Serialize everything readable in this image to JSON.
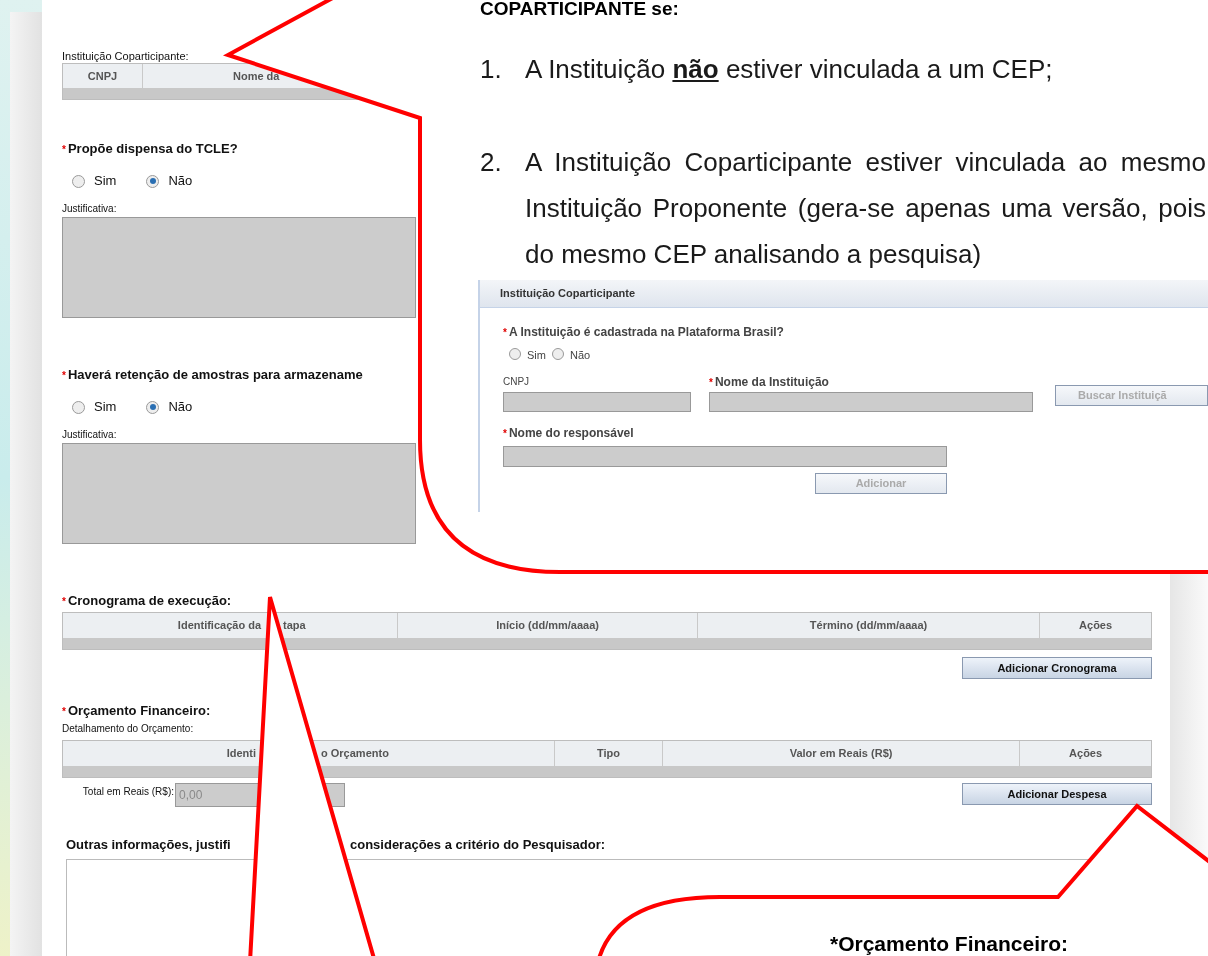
{
  "form": {
    "coparticipante": {
      "label": "Instituição Coparticipante:",
      "columns": [
        "CNPJ",
        "Nome da"
      ]
    },
    "questions": [
      {
        "marker": "*",
        "label": "Propõe dispensa do TCLE?",
        "options": [
          {
            "label": "Sim",
            "selected": false
          },
          {
            "label": "Não",
            "selected": true
          }
        ],
        "justification_label": "Justificativa:"
      },
      {
        "marker": "*",
        "label": "Haverá retenção de amostras para armazename",
        "options": [
          {
            "label": "Sim",
            "selected": false
          },
          {
            "label": "Não",
            "selected": true
          }
        ],
        "justification_label": "Justificativa:"
      }
    ],
    "cronograma": {
      "marker": "*",
      "label": "Cronograma de execução:",
      "columns": [
        {
          "parts": [
            "Identificação da",
            "tapa"
          ]
        },
        {
          "parts": [
            "Início (dd/mm/aaaa)"
          ]
        },
        {
          "parts": [
            "Término (dd/mm/aaaa)"
          ]
        },
        {
          "parts": [
            "Ações"
          ]
        }
      ],
      "button": "Adicionar Cronograma"
    },
    "orcamento": {
      "marker": "*",
      "label": "Orçamento Financeiro:",
      "sublabel": "Detalhamento do Orçamento:",
      "columns": [
        {
          "parts": [
            "Identi",
            "o Orçamento"
          ]
        },
        {
          "parts": [
            "Tipo"
          ]
        },
        {
          "parts": [
            "Valor em Reais (R$)"
          ]
        },
        {
          "parts": [
            "Ações"
          ]
        }
      ],
      "total_label": "Total em Reais (R$):",
      "total_value": "0,00",
      "button": "Adicionar Despesa"
    },
    "outras": {
      "label_parts": [
        "Outras informações, justifi",
        "considerações a critério do Pesquisador:"
      ]
    }
  },
  "callouts": [
    {
      "kind": "top",
      "heading": "COPARTICIPANTE se:",
      "items": [
        {
          "number": "1.",
          "lines": [
            "A Instituição **não** estiver vinculada a um CEP;"
          ]
        },
        {
          "number": "2.",
          "lines": [
            "A Instituição Coparticipante estiver vinculada ao mesmo",
            "Instituição Proponente (gera-se apenas uma versão, pois",
            "do mesmo CEP analisando a pesquisa)"
          ]
        }
      ],
      "screenshot": {
        "title": "Instituição Coparticipante",
        "question": {
          "marker": "*",
          "label": "A Instituição é cadastrada na Plataforma Brasil?",
          "options": [
            {
              "label": "Sim",
              "selected": false
            },
            {
              "label": "Não",
              "selected": false
            }
          ]
        },
        "cnpj_label": "CNPJ",
        "name_marker": "*",
        "name_label": "Nome da Instituição",
        "search_button": "Buscar Instituiçã",
        "resp_marker": "*",
        "resp_label": "Nome do responsável",
        "add_button": "Adicionar"
      }
    },
    {
      "kind": "bottom",
      "heading": "*Orçamento Financeiro:"
    },
    {
      "kind": "pointer"
    }
  ]
}
